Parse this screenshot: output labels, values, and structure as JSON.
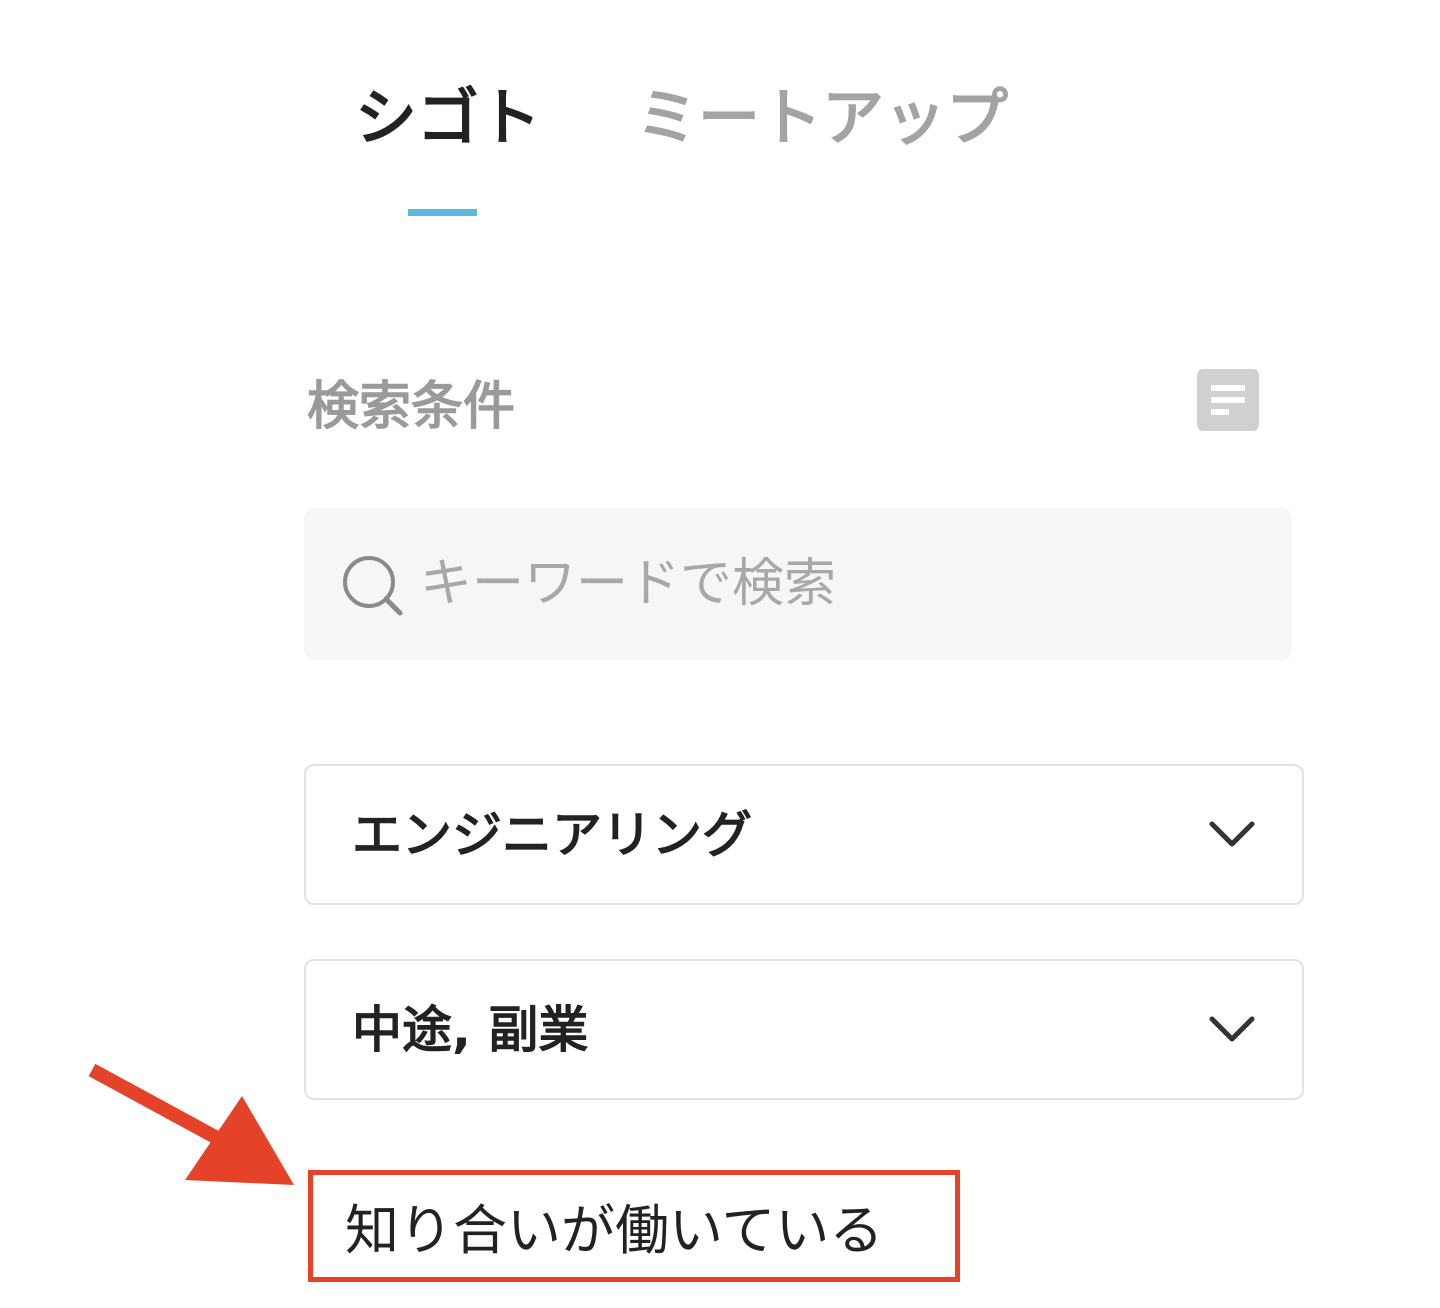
{
  "tabs": [
    {
      "label": "シゴト",
      "active": true
    },
    {
      "label": "ミートアップ",
      "active": false
    }
  ],
  "accent_color": "#5bb9dd",
  "annotation_color": "#e4432a",
  "search_section": {
    "title": "検索条件",
    "saved_conditions_icon": "document-list-icon",
    "search": {
      "placeholder": "キーワードで検索",
      "value": "",
      "icon": "search-icon"
    }
  },
  "filters": [
    {
      "value": "エンジニアリング",
      "icon": "chevron-down-icon"
    },
    {
      "value": "中途, 副業",
      "icon": "chevron-down-icon"
    }
  ],
  "acquaintance_filter": {
    "label": "知り合いが働いている"
  }
}
